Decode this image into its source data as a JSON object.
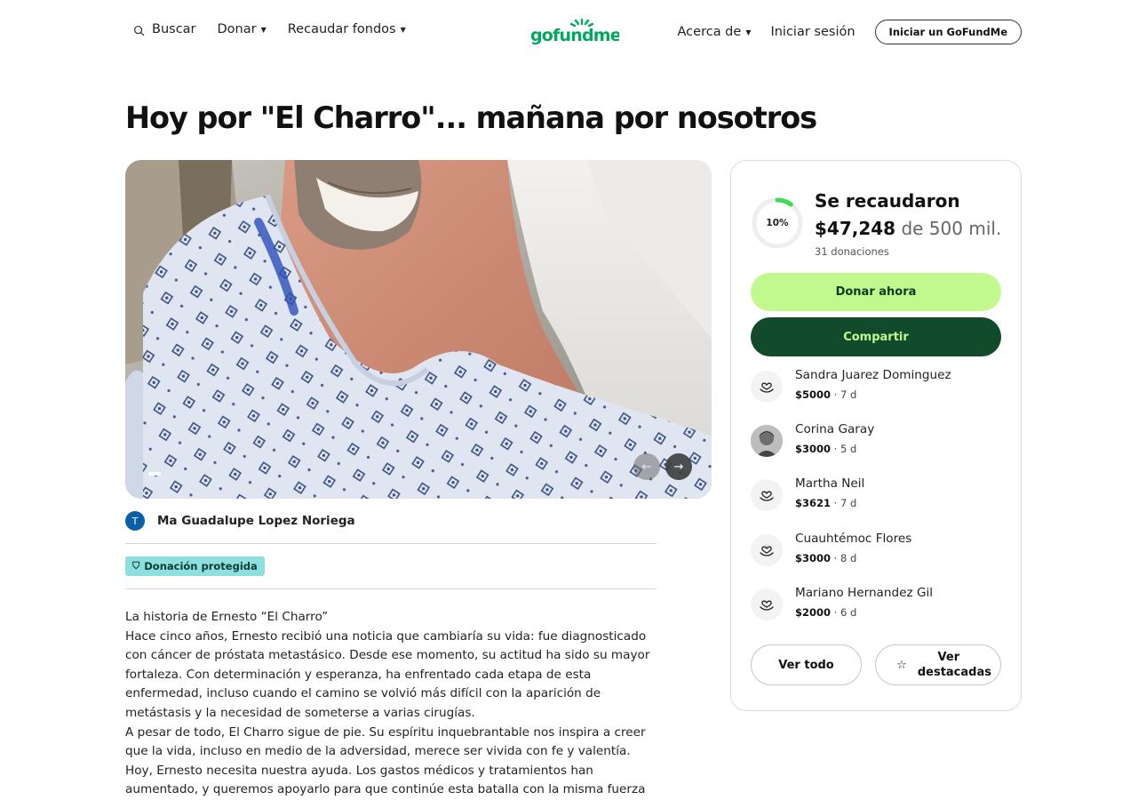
{
  "nav": {
    "search_label": "Buscar",
    "donate_label": "Donar",
    "fundraise_label": "Recaudar fondos",
    "about_label": "Acerca de",
    "login_label": "Iniciar sesión",
    "start_label": "Iniciar un GoFundMe"
  },
  "brand": {
    "logo_text": "gofundme",
    "accent": "#02a95c"
  },
  "campaign": {
    "title": "Hoy por \"El Charro\"... mañana por nosotros",
    "organizer_initial": "T",
    "organizer_name": "Ma Guadalupe Lopez Noriega",
    "badge_label": "Donación protegida"
  },
  "story": [
    "La historia de Ernesto “El Charro”",
    "Hace cinco años, Ernesto recibió una noticia que cambiaría su vida: fue diagnosticado con cáncer de próstata metastásico. Desde ese momento, su actitud ha sido su mayor fortaleza. Con determinación y esperanza, ha enfrentado cada etapa de esta enfermedad, incluso cuando el camino se volvió más difícil con la aparición de metástasis y la necesidad de someterse a varias cirugías.",
    "A pesar de todo, El Charro sigue de pie. Su espíritu inquebrantable nos inspira a creer que la vida, incluso en medio de la adversidad, merece ser vivida con fe y valentía.",
    "Hoy, Ernesto necesita nuestra ayuda. Los gastos médicos y tratamientos han aumentado, y queremos apoyarlo para que continúe esta batalla con la misma fuerza que lo ha"
  ],
  "progress": {
    "percent_label": "10%",
    "percent": 10,
    "heading": "Se recaudaron",
    "amount": "$47,248",
    "goal_text": "de 500 mil.",
    "donations_count": "31 donaciones"
  },
  "actions": {
    "donate_label": "Donar ahora",
    "share_label": "Compartir"
  },
  "donors": [
    {
      "name": "Sandra Juarez Dominguez",
      "amount": "$5000",
      "time": " · 7 d",
      "avatar": "heart-hand-icon"
    },
    {
      "name": "Corina Garay",
      "amount": "$3000",
      "time": " · 5 d",
      "avatar": "photo"
    },
    {
      "name": "Martha Neil",
      "amount": "$3621",
      "time": " · 7 d",
      "avatar": "heart-hand-icon"
    },
    {
      "name": "Cuauhtémoc Flores",
      "amount": "$3000",
      "time": " · 8 d",
      "avatar": "heart-hand-icon"
    },
    {
      "name": "Mariano Hernandez Gil",
      "amount": "$2000",
      "time": " · 6 d",
      "avatar": "heart-hand-icon"
    }
  ],
  "donor_buttons": {
    "all_label": "Ver todo",
    "top_label": "Ver destacadas"
  },
  "colors": {
    "donate_bg": "#c1f98f",
    "share_bg": "#124a2c",
    "badge_bg": "#8ee0df",
    "progress_ring": "#3ddc5a"
  }
}
